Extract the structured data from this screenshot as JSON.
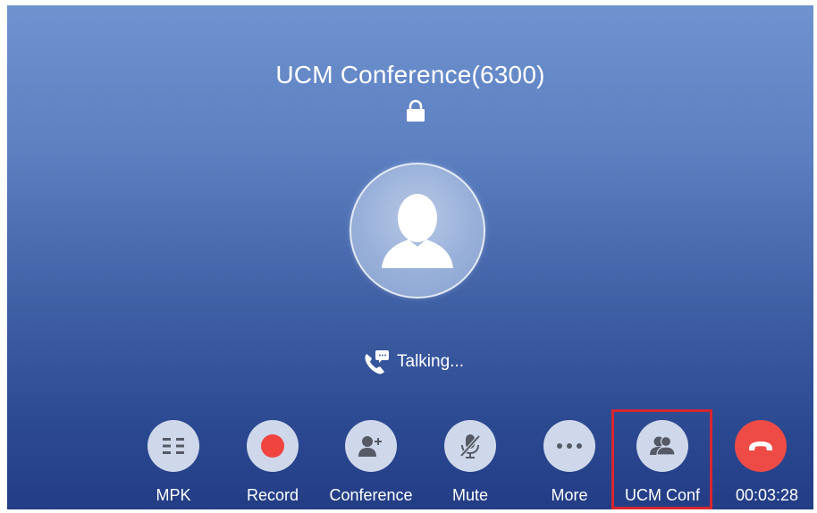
{
  "call": {
    "title": "UCM Conference(6300)",
    "status": "Talking...",
    "duration": "00:03:28"
  },
  "icons": {
    "lock": "lock-icon",
    "avatar": "person-silhouette-icon",
    "status": "phone-chat-icon"
  },
  "actions": [
    {
      "id": "mpk",
      "label": "MPK",
      "icon": "grid-icon"
    },
    {
      "id": "record",
      "label": "Record",
      "icon": "record-dot-icon"
    },
    {
      "id": "conference",
      "label": "Conference",
      "icon": "add-person-icon"
    },
    {
      "id": "mute",
      "label": "Mute",
      "icon": "mic-mute-icon"
    },
    {
      "id": "more",
      "label": "More",
      "icon": "more-dots-icon"
    },
    {
      "id": "ucm-conf",
      "label": "UCM Conf",
      "icon": "group-icon",
      "highlighted": true
    },
    {
      "id": "hangup",
      "label": "",
      "icon": "hangup-icon"
    }
  ],
  "colors": {
    "background_top": "#6f93cf",
    "background_bottom": "#233d85",
    "button_bg": "#cfd8ea",
    "record_red": "#f0443f",
    "hangup_red": "#ef4b46",
    "highlight_red": "#d9262e"
  }
}
